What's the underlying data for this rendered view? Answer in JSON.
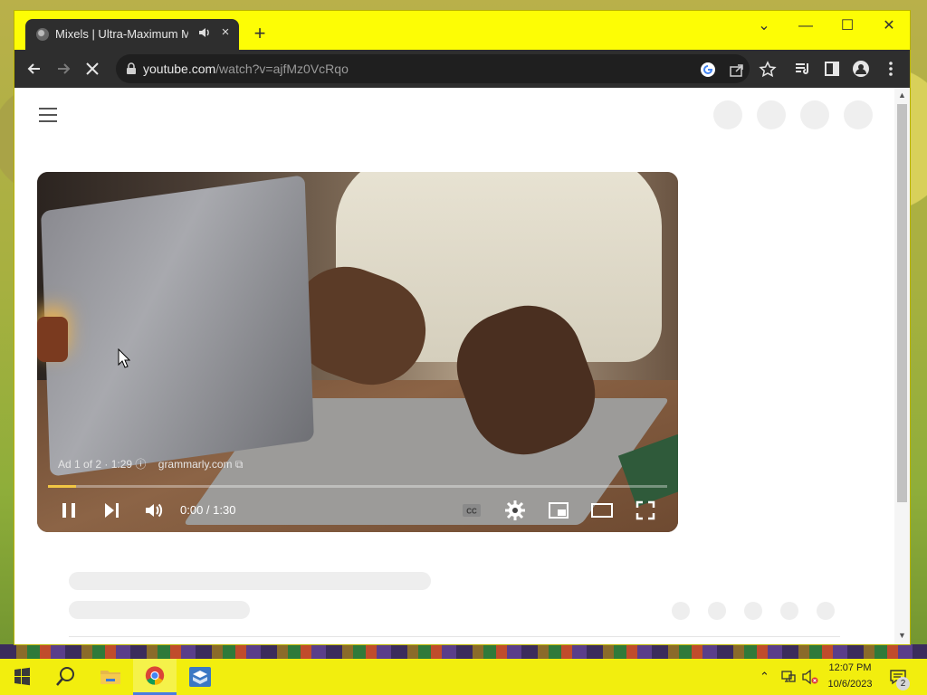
{
  "browser": {
    "tab": {
      "title": "Mixels | Ultra-Maximum Ma",
      "close_icon": "×"
    },
    "new_tab": "+",
    "window_controls": {
      "minimize": "—",
      "maximize": "☐",
      "close": "✕",
      "tab_search": "⌄"
    },
    "url": {
      "host": "youtube.com",
      "path": "/watch?v=ajfMz0VcRqo"
    }
  },
  "player": {
    "ad_info": "Ad 1 of 2 · 1:29",
    "advertiser": "grammarly.com",
    "time": "0:00 / 1:30",
    "progress_fraction": 0.045
  },
  "taskbar": {
    "time": "12:07 PM",
    "date": "10/6/2023",
    "notification_count": "2"
  },
  "colors": {
    "tabbar": "#fdfd05",
    "toolbar": "#2e2e2e",
    "progress_ad": "#f1c644",
    "taskbar": "#f2ee0e"
  }
}
